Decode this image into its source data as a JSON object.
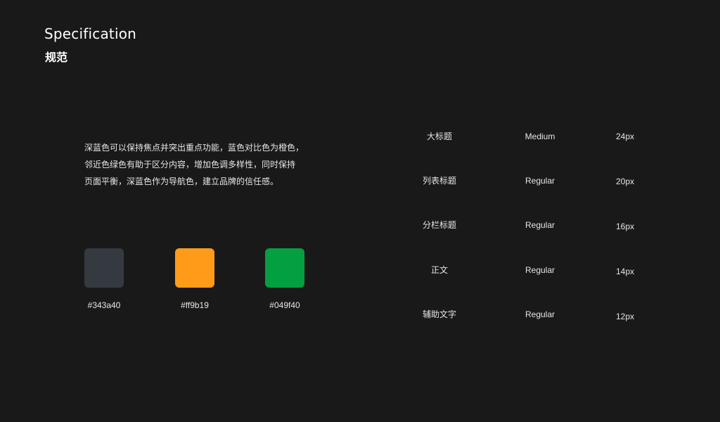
{
  "header": {
    "title_en": "Specification",
    "title_cn": "规范"
  },
  "description": {
    "lines": [
      "深蓝色可以保持焦点并突出重点功能，蓝色对比色为橙色，",
      "邻近色绿色有助于区分内容，增加色调多样性，同时保持",
      "页面平衡，深蓝色作为导航色，建立品牌的信任感。"
    ]
  },
  "colors": [
    {
      "hex": "#343a40",
      "label": "#343a40"
    },
    {
      "hex": "#ff9b19",
      "label": "#ff9b19"
    },
    {
      "hex": "#049f40",
      "label": "#049f40"
    }
  ],
  "typography": [
    {
      "name": "大标题",
      "weight": "Medium",
      "size": "24px"
    },
    {
      "name": "列表标题",
      "weight": "Regular",
      "size": "20px"
    },
    {
      "name": "分栏标题",
      "weight": "Regular",
      "size": "16px"
    },
    {
      "name": "正文",
      "weight": "Regular",
      "size": "14px"
    },
    {
      "name": "辅助文字",
      "weight": "Regular",
      "size": "12px"
    }
  ]
}
